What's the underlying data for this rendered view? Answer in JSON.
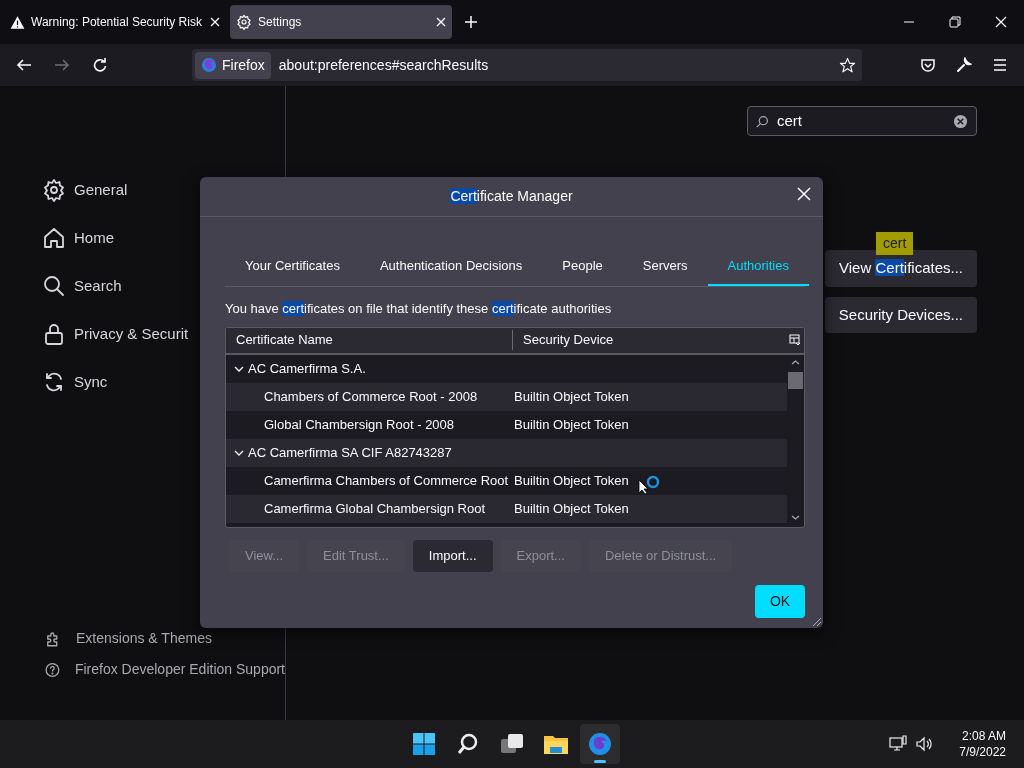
{
  "browser": {
    "tabs": [
      {
        "label": "Warning: Potential Security Risk",
        "selected": false
      },
      {
        "label": "Settings",
        "selected": true
      }
    ],
    "identity": "Firefox",
    "url": "about:preferences#searchResults"
  },
  "sidebar": {
    "items": [
      {
        "label": "General"
      },
      {
        "label": "Home"
      },
      {
        "label": "Search"
      },
      {
        "label": "Privacy & Securit"
      },
      {
        "label": "Sync"
      }
    ],
    "footer": [
      {
        "label": "Extensions & Themes"
      },
      {
        "label": "Firefox Developer Edition Support"
      }
    ]
  },
  "search": {
    "value": "cert"
  },
  "settings": {
    "tooltip": "cert",
    "buttons": [
      {
        "parts": [
          {
            "text": "View ",
            "highlight": false
          },
          {
            "text": "Cert",
            "highlight": true
          },
          {
            "text": "ificates...",
            "highlight": false
          }
        ]
      },
      {
        "parts": [
          {
            "text": "Security Devices...",
            "highlight": false
          }
        ]
      }
    ]
  },
  "dialog": {
    "title": [
      {
        "text": "Cert",
        "highlight": true
      },
      {
        "text": "ificate Manager",
        "highlight": false
      }
    ],
    "tabs": [
      {
        "label": "Your Certificates",
        "selected": false
      },
      {
        "label": "Authentication Decisions",
        "selected": false
      },
      {
        "label": "People",
        "selected": false
      },
      {
        "label": "Servers",
        "selected": false
      },
      {
        "label": "Authorities",
        "selected": true
      }
    ],
    "description": [
      {
        "text": "You have ",
        "highlight": false
      },
      {
        "text": "cert",
        "highlight": true
      },
      {
        "text": "ificates on file that identify these ",
        "highlight": false
      },
      {
        "text": "cert",
        "highlight": true
      },
      {
        "text": "ificate authorities",
        "highlight": false
      }
    ],
    "columns": [
      "Certificate Name",
      "Security Device"
    ],
    "groups": [
      {
        "name": "AC Camerfirma S.A.",
        "expanded": true,
        "children": [
          {
            "name": "Chambers of Commerce Root - 2008",
            "device": "Builtin Object Token"
          },
          {
            "name": "Global Chambersign Root - 2008",
            "device": "Builtin Object Token"
          }
        ]
      },
      {
        "name": "AC Camerfirma SA CIF A82743287",
        "expanded": true,
        "children": [
          {
            "name": "Camerfirma Chambers of Commerce Root",
            "device": "Builtin Object Token"
          },
          {
            "name": "Camerfirma Global Chambersign Root",
            "device": "Builtin Object Token"
          }
        ]
      }
    ],
    "buttons": [
      {
        "label": "View...",
        "disabled": true
      },
      {
        "label": "Edit Trust...",
        "disabled": true
      },
      {
        "label": "Import...",
        "disabled": false
      },
      {
        "label": "Export...",
        "disabled": true
      },
      {
        "label": "Delete or Distrust...",
        "disabled": true
      }
    ],
    "ok": "OK"
  },
  "taskbar": {
    "apps": [
      {
        "kind": "start",
        "active": false
      },
      {
        "kind": "search",
        "active": false
      },
      {
        "kind": "taskview",
        "active": false
      },
      {
        "kind": "explorer",
        "active": false
      },
      {
        "kind": "firefox",
        "active": true
      }
    ],
    "time": "2:08 AM",
    "date": "7/9/2022"
  }
}
